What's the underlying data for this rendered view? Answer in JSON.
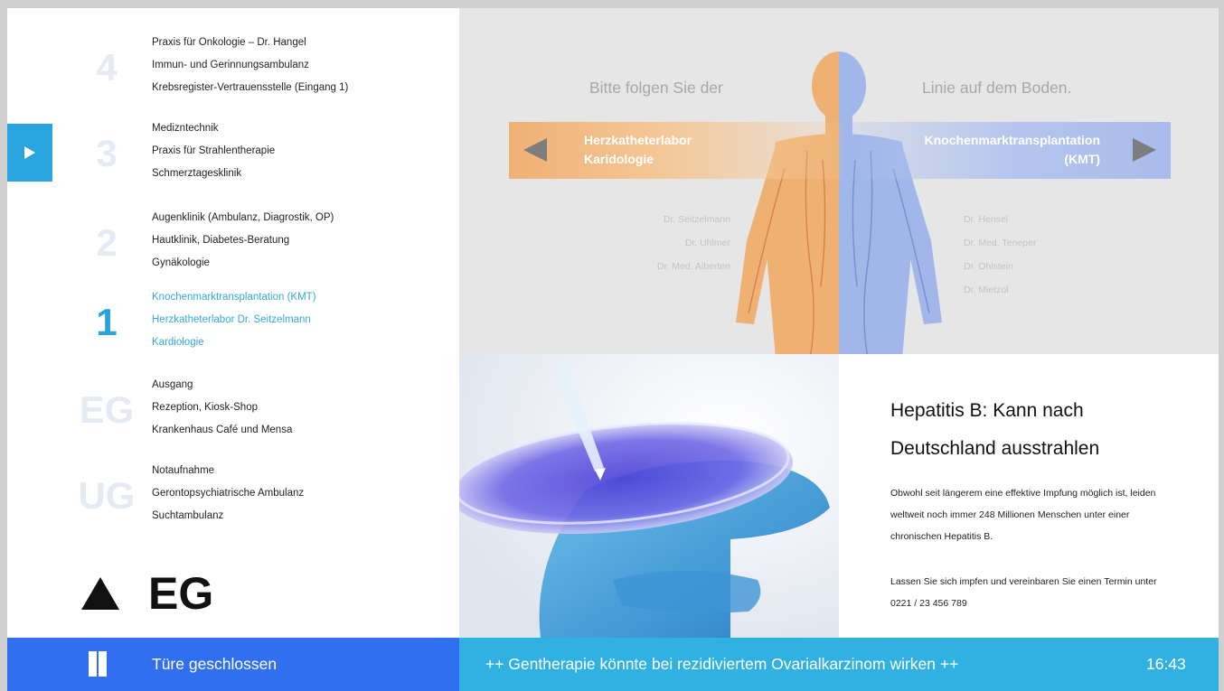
{
  "floors": [
    {
      "id": "4",
      "items": [
        "Praxis für Onkologie – Dr. Hangel",
        "Immun- und Gerinnungsambulanz",
        "Krebsregister-Vertrauensstelle (Eingang 1)"
      ]
    },
    {
      "id": "3",
      "items": [
        "Medizntechnik",
        "Praxis für Strahlentherapie",
        "Schmerztagesklinik"
      ]
    },
    {
      "id": "2",
      "items": [
        "Augenklinik (Ambulanz, Diagrostik, OP)",
        "Hautklinik, Diabetes-Beratung",
        "Gynäkologie"
      ]
    },
    {
      "id": "1",
      "items": [
        "Knochenmarktransplantation (KMT)",
        "Herzkatheterlabor Dr. Seitzelmann",
        "Kardiologie"
      ]
    },
    {
      "id": "EG",
      "items": [
        "Ausgang",
        "Rezeption, Kiosk-Shop",
        "Krankenhaus Café und Mensa"
      ]
    },
    {
      "id": "UG",
      "items": [
        "Notaufnahme",
        "Gerontopsychiatrische Ambulanz",
        "Suchtambulanz"
      ]
    }
  ],
  "current_floor": "EG",
  "wayfinding": {
    "hint_left": "Bitte folgen Sie der",
    "hint_right": "Linie auf dem Boden.",
    "left_target_line1": "Herzkatheterlabor",
    "left_target_line2": "Karidologie",
    "right_target_line1": "Knochenmarktransplantation",
    "right_target_line2": "(KMT)",
    "left_doctors": [
      "Dr. Seitzelmann",
      "Dr. Uhlmer",
      "Dr. Med. Alberten"
    ],
    "right_doctors": [
      "Dr. Hensel",
      "Dr. Med. Teneper",
      "Dr. Ohlstein",
      "Dr. Mietzol"
    ],
    "colors": {
      "left_accent": "#f0b074",
      "right_accent": "#a9bbeb"
    }
  },
  "article": {
    "title": "Hepatitis B: Kann nach Deutschland ausstrahlen",
    "paragraph1": "Obwohl seit längerem eine effektive Impfung möglich ist, leiden weltweit noch immer 248 Millionen Menschen unter einer chronischen Hepatitis B.",
    "paragraph2": "Lassen Sie sich impfen und vereinbaren Sie einen Termin unter 0221 / 23 456 789"
  },
  "statusbar": {
    "door_status": "Türe geschlossen",
    "door_icon": "door-icon",
    "ticker": "++ Gentherapie könnte bei rezidiviertem Ovarialkarzinom wirken ++",
    "time": "16:43",
    "colors": {
      "left": "#2f6ff0",
      "right": "#30b1e1"
    }
  }
}
